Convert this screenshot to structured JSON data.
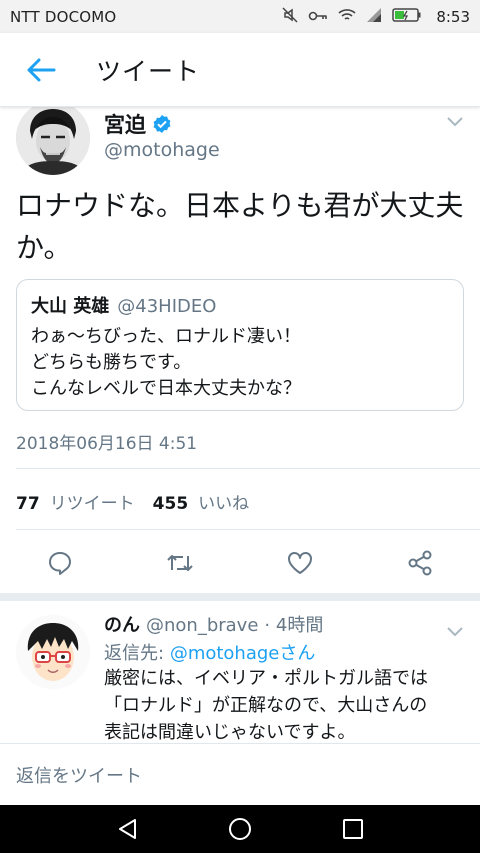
{
  "status_bar": {
    "carrier": "NTT DOCOMO",
    "time": "8:53",
    "icons": [
      "mute-icon",
      "key-icon",
      "wifi-icon",
      "signal-icon",
      "battery-icon"
    ]
  },
  "header": {
    "title": "ツイート",
    "back_icon": "arrow-left-icon"
  },
  "tweet": {
    "author_name": "宮迫",
    "author_handle": "@motohage",
    "verified": true,
    "text": "ロナウドな。日本よりも君が大丈夫か。",
    "quoted": {
      "name": "大山 英雄",
      "handle": "@43HIDEO",
      "text": "わぁ〜ちびった、ロナルド凄い！\nどちらも勝ちです。\nこんなレベルで日本大丈夫かな？"
    },
    "timestamp": "2018年06月16日 4:51",
    "retweet_count": "77",
    "retweet_label": "リツイート",
    "like_count": "455",
    "like_label": "いいね"
  },
  "actions": [
    "reply-icon",
    "retweet-icon",
    "like-icon",
    "share-icon"
  ],
  "reply": {
    "name": "のん",
    "handle": "@non_brave",
    "time": "· 4時間",
    "reply_to_label": "返信先:",
    "reply_to_handle": "@motohageさん",
    "text": "厳密には、イベリア・ポルトガル語では\n「ロナルド」が正解なので、大山さんの\n表記は間違いじゃないですよ。"
  },
  "composer": {
    "placeholder": "返信をツイート"
  },
  "colors": {
    "accent": "#1da1f2",
    "secondary_text": "#657786",
    "primary_text": "#14171a"
  }
}
